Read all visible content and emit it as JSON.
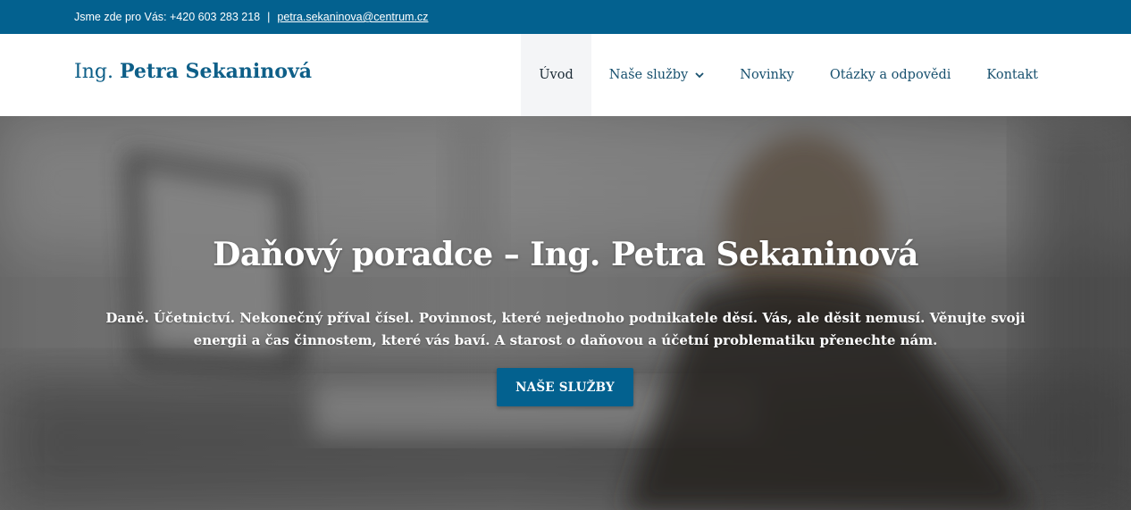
{
  "topbar": {
    "contact_text": "Jsme zde pro Vás: +420 603 283 218",
    "separator": "|",
    "email": "petra.sekaninova@centrum.cz"
  },
  "logo": {
    "prefix": "Ing.",
    "name": "Petra Sekaninová"
  },
  "nav": {
    "items": [
      {
        "label": "Úvod",
        "active": true
      },
      {
        "label": "Naše služby",
        "has_dropdown": true
      },
      {
        "label": "Novinky"
      },
      {
        "label": "Otázky a odpovědi"
      },
      {
        "label": "Kontakt"
      }
    ]
  },
  "hero": {
    "title": "Daňový poradce – Ing. Petra Sekaninová",
    "subtitle": "Daně. Účetnictví. Nekonečný příval čísel. Povinnost, které nejednoho podnikatele děsí. Vás, ale děsit nemusí. Věnujte svoji energii a čas činnostem, které vás baví. A starost o daňovou a účetní problematiku přenechte nám.",
    "button_label": "NAŠE SLUŽBY"
  },
  "colors": {
    "brand": "#03618f",
    "nav_text": "#17506e",
    "active_bg": "#f4f5f7"
  },
  "icons": {
    "dropdown": "chevron-down-icon"
  }
}
